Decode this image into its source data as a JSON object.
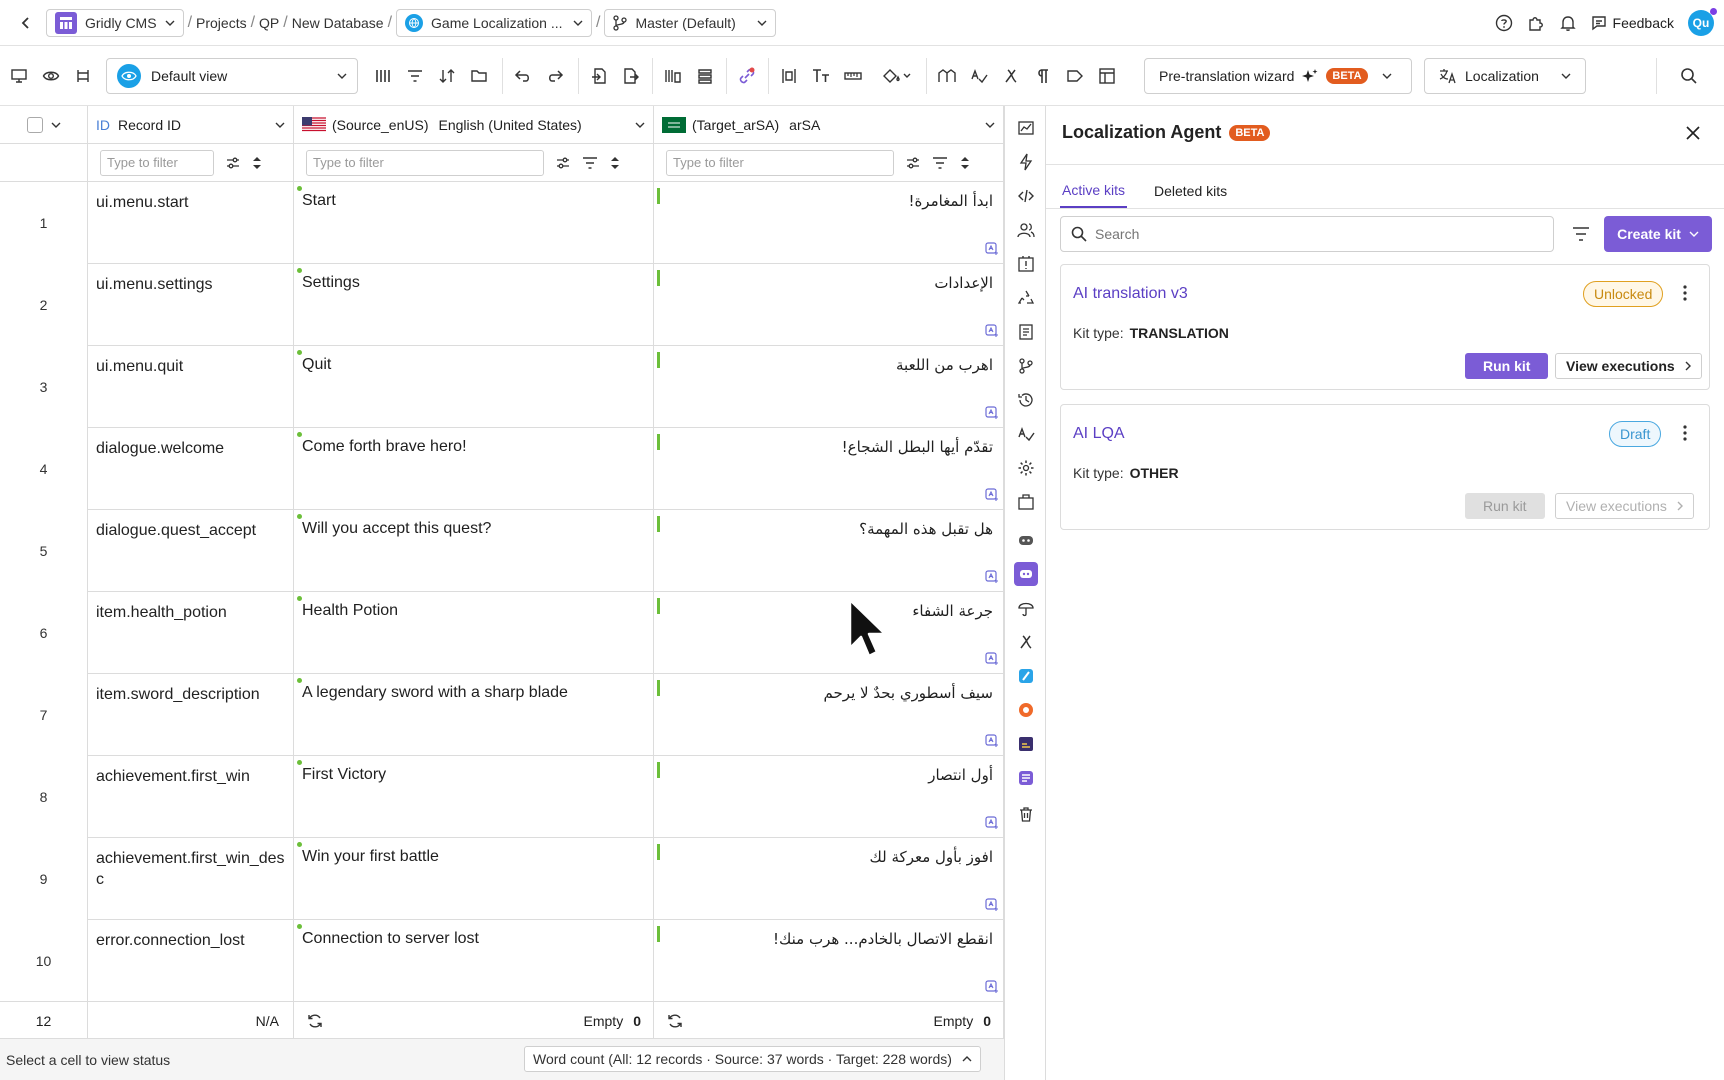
{
  "topbar": {
    "app_name": "Gridly CMS",
    "breadcrumbs": [
      "Projects",
      "QP",
      "New Database"
    ],
    "database": "Game Localization ...",
    "branch": "Master (Default)",
    "feedback": "Feedback",
    "avatar": "Qu"
  },
  "toolbar": {
    "view": "Default view",
    "wizard": "Pre-translation wizard",
    "beta": "BETA",
    "localization": "Localization"
  },
  "grid": {
    "columns": {
      "id": {
        "label": "Record ID",
        "prefix": "ID"
      },
      "source": {
        "code": "(Source_enUS)",
        "label": "English (United States)"
      },
      "target": {
        "code": "(Target_arSA)",
        "label": "arSA"
      }
    },
    "filter_placeholder": "Type to filter",
    "rows": [
      {
        "num": "1",
        "id": "ui.menu.start",
        "source": "Start",
        "target": "ابدأ المغامرة!"
      },
      {
        "num": "2",
        "id": "ui.menu.settings",
        "source": "Settings",
        "target": "الإعدادات"
      },
      {
        "num": "3",
        "id": "ui.menu.quit",
        "source": "Quit",
        "target": "اهرب من اللعبة"
      },
      {
        "num": "4",
        "id": "dialogue.welcome",
        "source": "Come forth brave hero!",
        "target": "تقدّم أيها البطل الشجاع!"
      },
      {
        "num": "5",
        "id": "dialogue.quest_accept",
        "source": "Will you accept this quest?",
        "target": "هل تقبل هذه المهمة؟"
      },
      {
        "num": "6",
        "id": "item.health_potion",
        "source": "Health Potion",
        "target": "جرعة الشفاء"
      },
      {
        "num": "7",
        "id": "item.sword_description",
        "source": "A legendary sword with a sharp blade",
        "target": "سيف أسطوري بحدٌ لا يرحم"
      },
      {
        "num": "8",
        "id": "achievement.first_win",
        "source": "First Victory",
        "target": "أول انتصار"
      },
      {
        "num": "9",
        "id": "achievement.first_win_desc",
        "source": "Win your first battle",
        "target": "افوز بأول معركة لك"
      },
      {
        "num": "10",
        "id": "error.connection_lost",
        "source": "Connection to server lost",
        "target": "انقطع الاتصال بالخادم... هرب منك!"
      }
    ],
    "footer": {
      "count": "12",
      "id_value": "N/A",
      "source_empty_label": "Empty",
      "source_empty_count": "0",
      "target_empty_label": "Empty",
      "target_empty_count": "0"
    }
  },
  "status": {
    "hint": "Select a cell to view status",
    "word_count": "Word count (All: 12 records · Source: 37 words · Target: 228 words)"
  },
  "panel": {
    "title": "Localization Agent",
    "beta": "BETA",
    "tabs": [
      "Active kits",
      "Deleted kits"
    ],
    "search_placeholder": "Search",
    "create_kit": "Create kit",
    "kit_type_label": "Kit type:",
    "kits": [
      {
        "name": "AI translation v3",
        "status": "Unlocked",
        "type": "TRANSLATION",
        "run": "Run kit",
        "exec": "View executions"
      },
      {
        "name": "AI LQA",
        "status": "Draft",
        "type": "OTHER",
        "run": "Run kit",
        "exec": "View executions"
      }
    ]
  },
  "colors": {
    "accent": "#7b5cd6",
    "brand_blue": "#1aa0e6",
    "beta_orange": "#e25c1f",
    "unlocked": "#e0a020",
    "draft": "#4aa8e0"
  }
}
